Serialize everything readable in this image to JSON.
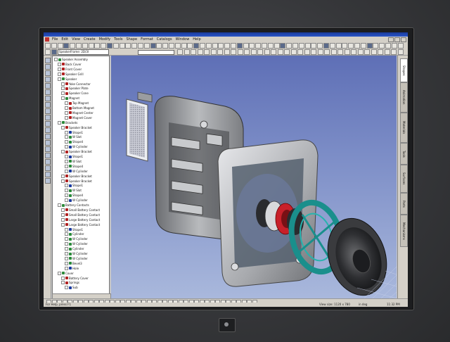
{
  "menu": {
    "items": [
      "File",
      "Edit",
      "View",
      "Create",
      "Modify",
      "Tools",
      "Shape",
      "Format",
      "Catalogs",
      "Window",
      "Help"
    ]
  },
  "toolbar": {
    "part_selector": "SpeakerFrame: 2D/3I"
  },
  "tree": {
    "items": [
      {
        "label": "Speaker Assembly",
        "level": 0,
        "color": "#2a8a3a"
      },
      {
        "label": "Back Cover",
        "level": 1,
        "color": "#b02020"
      },
      {
        "label": "Front Cover",
        "level": 1,
        "color": "#b02020"
      },
      {
        "label": "Speaker Grill",
        "level": 1,
        "color": "#b02020"
      },
      {
        "label": "Speaker",
        "level": 1,
        "color": "#2a8a3a"
      },
      {
        "label": "Yoke Connector",
        "level": 2,
        "color": "#b02020"
      },
      {
        "label": "Speaker Plate",
        "level": 2,
        "color": "#b02020"
      },
      {
        "label": "Speaker Cone",
        "level": 2,
        "color": "#b02020"
      },
      {
        "label": "Magnet",
        "level": 2,
        "color": "#2a8a3a"
      },
      {
        "label": "Top Magnet",
        "level": 3,
        "color": "#b02020"
      },
      {
        "label": "Bottom Magnet",
        "level": 3,
        "color": "#b02020"
      },
      {
        "label": "Magnet Center",
        "level": 3,
        "color": "#b02020"
      },
      {
        "label": "Magnet Cover",
        "level": 3,
        "color": "#b02020"
      },
      {
        "label": "Brackets",
        "level": 1,
        "color": "#2a8a3a"
      },
      {
        "label": "Speaker Bracket",
        "level": 2,
        "color": "#b02020"
      },
      {
        "label": "Shape1",
        "level": 3,
        "color": "#1a3aa0"
      },
      {
        "label": "W Slot",
        "level": 3,
        "color": "#2a8a3a"
      },
      {
        "label": "Shape4",
        "level": 3,
        "color": "#2a8a3a"
      },
      {
        "label": "W Cylinder",
        "level": 3,
        "color": "#1a3aa0"
      },
      {
        "label": "Speaker Bracket",
        "level": 2,
        "color": "#b02020"
      },
      {
        "label": "Shape1",
        "level": 3,
        "color": "#1a3aa0"
      },
      {
        "label": "W Slot",
        "level": 3,
        "color": "#2a8a3a"
      },
      {
        "label": "Shape4",
        "level": 3,
        "color": "#2a8a3a"
      },
      {
        "label": "W Cylinder",
        "level": 3,
        "color": "#1a3aa0"
      },
      {
        "label": "Speaker Bracket",
        "level": 2,
        "color": "#b02020"
      },
      {
        "label": "Speaker Bracket",
        "level": 2,
        "color": "#b02020"
      },
      {
        "label": "Shape1",
        "level": 3,
        "color": "#1a3aa0"
      },
      {
        "label": "W Slot",
        "level": 3,
        "color": "#2a8a3a"
      },
      {
        "label": "Shape4",
        "level": 3,
        "color": "#2a8a3a"
      },
      {
        "label": "W Cylinder",
        "level": 3,
        "color": "#1a3aa0"
      },
      {
        "label": "Battery Contacts",
        "level": 1,
        "color": "#2a8a3a"
      },
      {
        "label": "Small Battery Contact",
        "level": 2,
        "color": "#b02020"
      },
      {
        "label": "Small Battery Contact",
        "level": 2,
        "color": "#b02020"
      },
      {
        "label": "Large Battery Contact",
        "level": 2,
        "color": "#b02020"
      },
      {
        "label": "Large Battery Contact",
        "level": 2,
        "color": "#b02020"
      },
      {
        "label": "Shape1",
        "level": 3,
        "color": "#1a3aa0"
      },
      {
        "label": "Cylinder",
        "level": 3,
        "color": "#2a8a3a"
      },
      {
        "label": "W Cylinder",
        "level": 3,
        "color": "#2a8a3a"
      },
      {
        "label": "W Cylinder",
        "level": 3,
        "color": "#2a8a3a"
      },
      {
        "label": "Cylinder",
        "level": 3,
        "color": "#2a8a3a"
      },
      {
        "label": "W Cylinder",
        "level": 3,
        "color": "#2a8a3a"
      },
      {
        "label": "W Cylinder",
        "level": 3,
        "color": "#2a8a3a"
      },
      {
        "label": "Bevel3",
        "level": 3,
        "color": "#2a8a3a"
      },
      {
        "label": "Hole",
        "level": 3,
        "color": "#1a3aa0"
      },
      {
        "label": "Cover",
        "level": 1,
        "color": "#2a8a3a"
      },
      {
        "label": "Battery Cover",
        "level": 2,
        "color": "#b02020"
      },
      {
        "label": "Springs",
        "level": 2,
        "color": "#b02020"
      },
      {
        "label": "Sub",
        "level": 3,
        "color": "#1a3aa0"
      }
    ]
  },
  "right_tabs": [
    "Shapes",
    "Animation",
    "Materials",
    "Tools",
    "Surfaces",
    "Parts",
    "Mechanisms"
  ],
  "status": {
    "left": "For Help, press F1",
    "view_size": "View size: 1120 x 780",
    "angle": "in deg",
    "time": "11:32 PM"
  },
  "colors": {
    "viewport_top": "#5e6fb6",
    "viewport_bottom": "#a9b8dc",
    "teal_ring": "#1a8f8c",
    "red_ring": "#c8202a"
  }
}
